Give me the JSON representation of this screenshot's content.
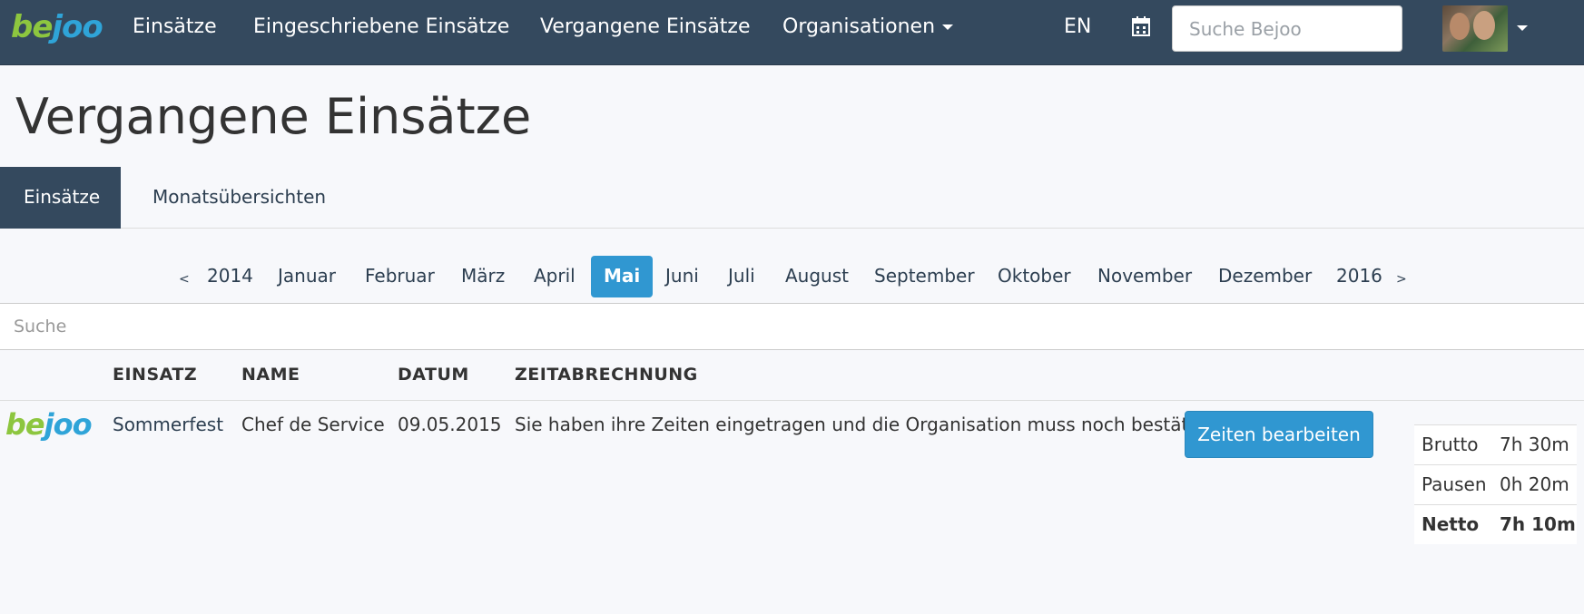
{
  "brand": {
    "part1": "be",
    "part2": "joo"
  },
  "nav": {
    "links": [
      "Einsätze",
      "Eingeschriebene Einsätze",
      "Vergangene Einsätze",
      "Organisationen"
    ],
    "language": "EN",
    "search_placeholder": "Suche Bejoo"
  },
  "page": {
    "title": "Vergangene Einsätze"
  },
  "tabs": [
    "Einsätze",
    "Monatsübersichten"
  ],
  "pager": {
    "prev_arrow": "<",
    "next_arrow": ">",
    "prev_year": "2014",
    "next_year": "2016",
    "months": [
      "Januar",
      "Februar",
      "März",
      "April",
      "Mai",
      "Juni",
      "Juli",
      "August",
      "September",
      "Oktober",
      "November",
      "Dezember"
    ],
    "active_month": "Mai"
  },
  "filter": {
    "placeholder": "Suche"
  },
  "table": {
    "headers": [
      "EINSATZ",
      "NAME",
      "DATUM",
      "ZEITABRECHNUNG"
    ],
    "rows": [
      {
        "einsatz": "Sommerfest",
        "name": "Chef de Service",
        "datum": "09.05.2015",
        "status": "Sie haben ihre Zeiten eingetragen und die Organisation muss noch bestätigen",
        "action": "Zeiten bearbeiten"
      }
    ]
  },
  "summary": [
    {
      "label": "Brutto",
      "value": "7h 30m"
    },
    {
      "label": "Pausen",
      "value": "0h 20m"
    },
    {
      "label": "Netto",
      "value": "7h 10m"
    }
  ],
  "colors": {
    "navbar": "#34495e",
    "accent": "#3097d1",
    "logo_green": "#8dc63f",
    "logo_blue": "#2fa4d8"
  }
}
